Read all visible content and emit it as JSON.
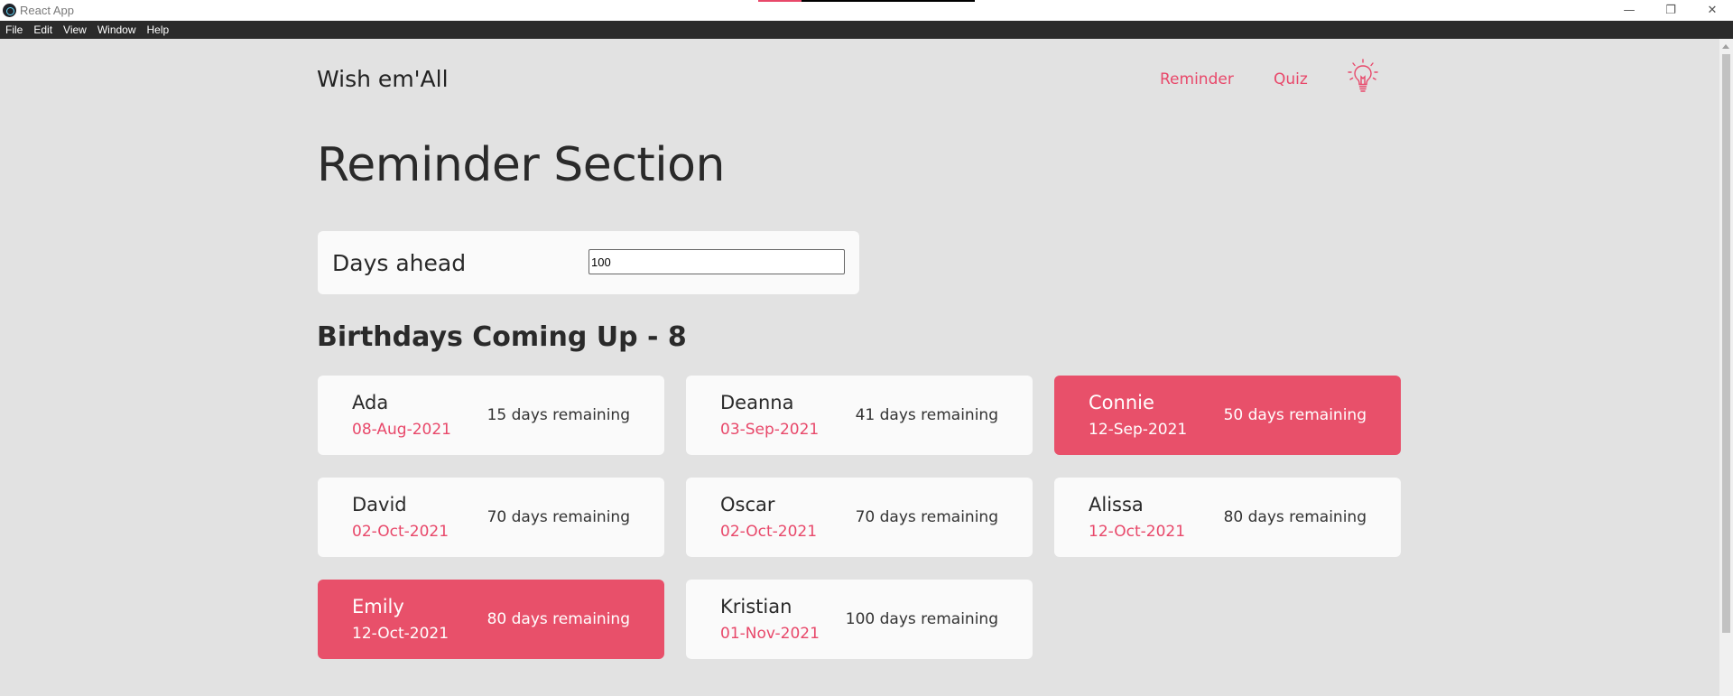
{
  "window": {
    "title": "React App",
    "progress": 0.2,
    "controls": {
      "minimize": "—",
      "restore": "❐",
      "close": "✕"
    }
  },
  "menubar": {
    "items": [
      {
        "label": "File"
      },
      {
        "label": "Edit"
      },
      {
        "label": "View"
      },
      {
        "label": "Window"
      },
      {
        "label": "Help"
      }
    ]
  },
  "header": {
    "brand": "Wish em'All",
    "nav": [
      {
        "label": "Reminder"
      },
      {
        "label": "Quiz"
      }
    ],
    "theme_toggle_icon": "lightbulb-icon"
  },
  "main": {
    "title": "Reminder Section",
    "days_ahead": {
      "label": "Days ahead",
      "value": "100"
    },
    "heading": "Birthdays Coming Up - 8",
    "birthdays": [
      {
        "name": "Ada",
        "date": "08-Aug-2021",
        "remaining": "15 days remaining",
        "highlight": false
      },
      {
        "name": "Deanna",
        "date": "03-Sep-2021",
        "remaining": "41 days remaining",
        "highlight": false
      },
      {
        "name": "Connie",
        "date": "12-Sep-2021",
        "remaining": "50 days remaining",
        "highlight": true
      },
      {
        "name": "David",
        "date": "02-Oct-2021",
        "remaining": "70 days remaining",
        "highlight": false
      },
      {
        "name": "Oscar",
        "date": "02-Oct-2021",
        "remaining": "70 days remaining",
        "highlight": false
      },
      {
        "name": "Alissa",
        "date": "12-Oct-2021",
        "remaining": "80 days remaining",
        "highlight": false
      },
      {
        "name": "Emily",
        "date": "12-Oct-2021",
        "remaining": "80 days remaining",
        "highlight": true
      },
      {
        "name": "Kristian",
        "date": "01-Nov-2021",
        "remaining": "100 days remaining",
        "highlight": false
      }
    ]
  },
  "colors": {
    "accent": "#e8486a",
    "highlight_card": "#e8506a",
    "background": "#e2e2e2",
    "card": "#fafafa"
  }
}
